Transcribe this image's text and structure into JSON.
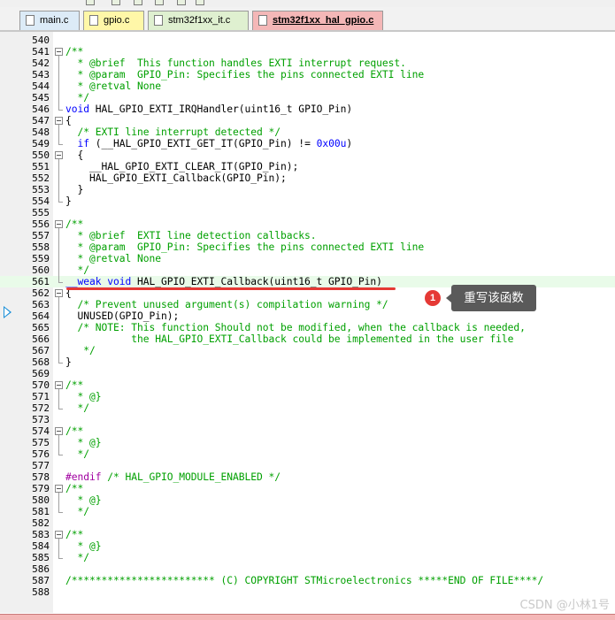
{
  "tabs": [
    {
      "label": "main.c",
      "active": false,
      "color": "#dcebf7"
    },
    {
      "label": "gpio.c",
      "active": false,
      "color": "#fff7a8"
    },
    {
      "label": "stm32f1xx_it.c",
      "active": false,
      "color": "#dff0d0"
    },
    {
      "label": "stm32f1xx_hal_gpio.c",
      "active": true,
      "color": "#f4b7b7"
    }
  ],
  "lines": [
    {
      "n": "540",
      "segs": []
    },
    {
      "n": "541",
      "fold": true,
      "segs": [
        {
          "c": "com",
          "t": "/**"
        }
      ]
    },
    {
      "n": "542",
      "segs": [
        {
          "c": "com",
          "t": "  * @brief  This function handles EXTI interrupt request."
        }
      ]
    },
    {
      "n": "543",
      "segs": [
        {
          "c": "com",
          "t": "  * @param  GPIO_Pin: Specifies the pins connected EXTI line"
        }
      ]
    },
    {
      "n": "544",
      "segs": [
        {
          "c": "com",
          "t": "  * @retval None"
        }
      ]
    },
    {
      "n": "545",
      "segs": [
        {
          "c": "com",
          "t": "  */"
        }
      ]
    },
    {
      "n": "546",
      "segs": [
        {
          "c": "kw",
          "t": "void"
        },
        {
          "c": "norm",
          "t": " HAL_GPIO_EXTI_IRQHandler(uint16_t GPIO_Pin)"
        }
      ]
    },
    {
      "n": "547",
      "fold": true,
      "segs": [
        {
          "c": "norm",
          "t": "{"
        }
      ]
    },
    {
      "n": "548",
      "segs": [
        {
          "c": "com",
          "t": "  /* EXTI line interrupt detected */"
        }
      ]
    },
    {
      "n": "549",
      "segs": [
        {
          "c": "kw",
          "t": "  if"
        },
        {
          "c": "norm",
          "t": " (__HAL_GPIO_EXTI_GET_IT(GPIO_Pin) != "
        },
        {
          "c": "num",
          "t": "0x00u"
        },
        {
          "c": "norm",
          "t": ")"
        }
      ]
    },
    {
      "n": "550",
      "fold": true,
      "segs": [
        {
          "c": "norm",
          "t": "  {"
        }
      ]
    },
    {
      "n": "551",
      "segs": [
        {
          "c": "norm",
          "t": "    __HAL_GPIO_EXTI_CLEAR_IT(GPIO_Pin);"
        }
      ]
    },
    {
      "n": "552",
      "segs": [
        {
          "c": "norm",
          "t": "    HAL_GPIO_EXTI_Callback(GPIO_Pin);"
        }
      ]
    },
    {
      "n": "553",
      "segs": [
        {
          "c": "norm",
          "t": "  }"
        }
      ]
    },
    {
      "n": "554",
      "segs": [
        {
          "c": "norm",
          "t": "}"
        }
      ]
    },
    {
      "n": "555",
      "segs": []
    },
    {
      "n": "556",
      "fold": true,
      "segs": [
        {
          "c": "com",
          "t": "/**"
        }
      ]
    },
    {
      "n": "557",
      "segs": [
        {
          "c": "com",
          "t": "  * @brief  EXTI line detection callbacks."
        }
      ]
    },
    {
      "n": "558",
      "segs": [
        {
          "c": "com",
          "t": "  * @param  GPIO_Pin: Specifies the pins connected EXTI line"
        }
      ]
    },
    {
      "n": "559",
      "segs": [
        {
          "c": "com",
          "t": "  * @retval None"
        }
      ]
    },
    {
      "n": "560",
      "segs": [
        {
          "c": "com",
          "t": "  */"
        }
      ]
    },
    {
      "n": "561",
      "hl": true,
      "segs": [
        {
          "c": "kw",
          "t": "__weak void"
        },
        {
          "c": "norm",
          "t": " HAL_GPIO_EXTI_Callback(uint16_t GPIO_Pin)"
        }
      ]
    },
    {
      "n": "562",
      "fold": true,
      "segs": [
        {
          "c": "norm",
          "t": "{"
        }
      ]
    },
    {
      "n": "563",
      "segs": [
        {
          "c": "com",
          "t": "  /* Prevent unused argument(s) compilation warning */"
        }
      ]
    },
    {
      "n": "564",
      "segs": [
        {
          "c": "norm",
          "t": "  UNUSED(GPIO_Pin);"
        }
      ]
    },
    {
      "n": "565",
      "segs": [
        {
          "c": "com",
          "t": "  /* NOTE: This function Should not be modified, when the callback is needed,"
        }
      ]
    },
    {
      "n": "566",
      "segs": [
        {
          "c": "com",
          "t": "           the HAL_GPIO_EXTI_Callback could be implemented in the user file"
        }
      ]
    },
    {
      "n": "567",
      "segs": [
        {
          "c": "com",
          "t": "   */"
        }
      ]
    },
    {
      "n": "568",
      "segs": [
        {
          "c": "norm",
          "t": "}"
        }
      ]
    },
    {
      "n": "569",
      "segs": []
    },
    {
      "n": "570",
      "fold": true,
      "segs": [
        {
          "c": "com",
          "t": "/**"
        }
      ]
    },
    {
      "n": "571",
      "segs": [
        {
          "c": "com",
          "t": "  * @}"
        }
      ]
    },
    {
      "n": "572",
      "segs": [
        {
          "c": "com",
          "t": "  */"
        }
      ]
    },
    {
      "n": "573",
      "segs": []
    },
    {
      "n": "574",
      "fold": true,
      "segs": [
        {
          "c": "com",
          "t": "/**"
        }
      ]
    },
    {
      "n": "575",
      "segs": [
        {
          "c": "com",
          "t": "  * @}"
        }
      ]
    },
    {
      "n": "576",
      "segs": [
        {
          "c": "com",
          "t": "  */"
        }
      ]
    },
    {
      "n": "577",
      "segs": []
    },
    {
      "n": "578",
      "segs": [
        {
          "c": "pp",
          "t": "#endif"
        },
        {
          "c": "com",
          "t": " /* HAL_GPIO_MODULE_ENABLED */"
        }
      ]
    },
    {
      "n": "579",
      "fold": true,
      "segs": [
        {
          "c": "com",
          "t": "/**"
        }
      ]
    },
    {
      "n": "580",
      "segs": [
        {
          "c": "com",
          "t": "  * @}"
        }
      ]
    },
    {
      "n": "581",
      "segs": [
        {
          "c": "com",
          "t": "  */"
        }
      ]
    },
    {
      "n": "582",
      "segs": []
    },
    {
      "n": "583",
      "fold": true,
      "segs": [
        {
          "c": "com",
          "t": "/**"
        }
      ]
    },
    {
      "n": "584",
      "segs": [
        {
          "c": "com",
          "t": "  * @}"
        }
      ]
    },
    {
      "n": "585",
      "segs": [
        {
          "c": "com",
          "t": "  */"
        }
      ]
    },
    {
      "n": "586",
      "segs": []
    },
    {
      "n": "587",
      "segs": [
        {
          "c": "com",
          "t": "/************************ (C) COPYRIGHT STMicroelectronics *****END OF FILE****/"
        }
      ]
    },
    {
      "n": "588",
      "segs": []
    }
  ],
  "annotation": {
    "badge": "1",
    "text": "重写该函数",
    "color": "#e53935"
  },
  "watermark": "CSDN @小林1号"
}
